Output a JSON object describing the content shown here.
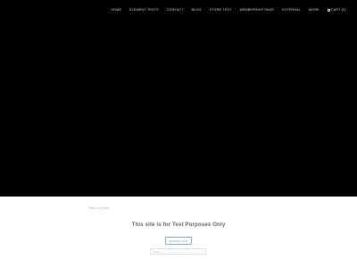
{
  "nav": {
    "items": [
      "HOME",
      "ELEMENT TESTS",
      "CONTACT",
      "BLOG",
      "STORE TEST",
      "MEMBERSHIP PAGE",
      "EXTERNAL",
      "MORE"
    ],
    "cart_label": "CART (",
    "cart_count": "0",
    "cart_close": ")"
  },
  "content": {
    "small_label": "Test tool kind",
    "heading": "This site is for Test Purposes Only",
    "enter_button": "ENTER SITE",
    "search_placeholder": "Search"
  }
}
